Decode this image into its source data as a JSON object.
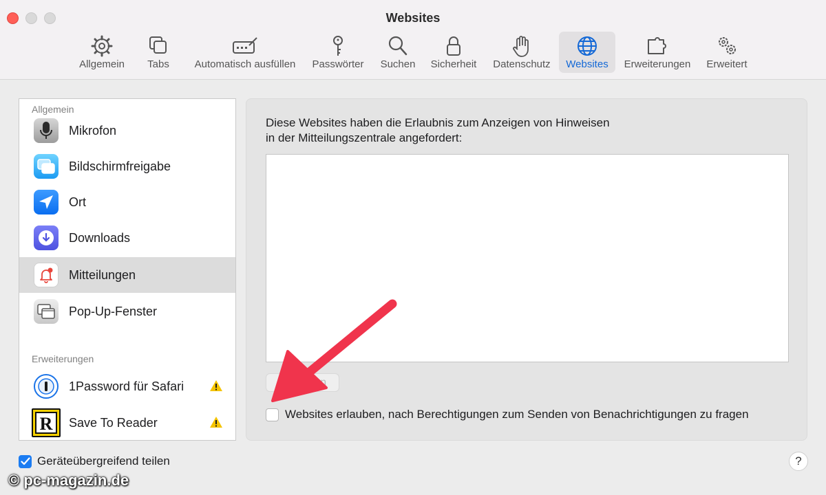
{
  "window": {
    "title": "Websites"
  },
  "toolbar": {
    "tabs": [
      {
        "label": "Allgemein",
        "icon": "gear-icon"
      },
      {
        "label": "Tabs",
        "icon": "tabs-icon"
      },
      {
        "label": "Automatisch ausfüllen",
        "icon": "autofill-icon"
      },
      {
        "label": "Passwörter",
        "icon": "key-icon"
      },
      {
        "label": "Suchen",
        "icon": "search-icon"
      },
      {
        "label": "Sicherheit",
        "icon": "lock-icon"
      },
      {
        "label": "Datenschutz",
        "icon": "hand-icon"
      },
      {
        "label": "Websites",
        "icon": "globe-icon",
        "active": true
      },
      {
        "label": "Erweiterungen",
        "icon": "puzzle-icon"
      },
      {
        "label": "Erweitert",
        "icon": "gears-icon"
      }
    ]
  },
  "sidebar": {
    "general_header": "Allgemein",
    "items": [
      {
        "label": "Mikrofon",
        "icon": "microphone-icon"
      },
      {
        "label": "Bildschirmfreigabe",
        "icon": "screen-share-icon"
      },
      {
        "label": "Ort",
        "icon": "location-icon"
      },
      {
        "label": "Downloads",
        "icon": "download-icon"
      },
      {
        "label": "Mitteilungen",
        "icon": "notification-bell-icon",
        "selected": true
      },
      {
        "label": "Pop-Up-Fenster",
        "icon": "popup-window-icon"
      }
    ],
    "extensions_header": "Erweiterungen",
    "extensions": [
      {
        "label": "1Password für Safari",
        "icon": "1password-icon",
        "warning": true
      },
      {
        "label": "Save To Reader",
        "icon": "reader-icon",
        "warning": true
      }
    ]
  },
  "main": {
    "description_line1": "Diese Websites haben die Erlaubnis zum Anzeigen von Hinweisen",
    "description_line2": "in der Mitteilungszentrale angefordert:",
    "remove_button": "Entfernen",
    "allow_checkbox_label": "Websites erlauben, nach Berechtigungen zum Senden von Benachrichtigungen zu fragen",
    "allow_checked": false
  },
  "footer": {
    "share_label": "Geräteübergreifend teilen",
    "share_checked": true,
    "help_label": "?"
  },
  "watermark": "© pc-magazin.de",
  "colors": {
    "accent": "#1368d6",
    "checkbox_on": "#1b7cf2",
    "arrow": "#f0344c",
    "warning": "#f5c400"
  }
}
